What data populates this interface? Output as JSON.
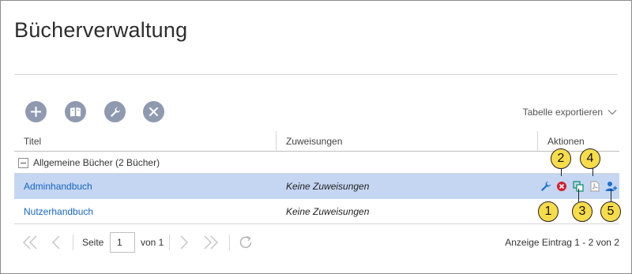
{
  "page": {
    "title": "Bücherverwaltung"
  },
  "toolbar": {
    "buttons": [
      {
        "icon": "plus-icon",
        "label": "Hinzufügen"
      },
      {
        "icon": "book-icon",
        "label": "Bücher"
      },
      {
        "icon": "wrench-icon",
        "label": "Bearbeiten"
      },
      {
        "icon": "close-icon",
        "label": "Löschen"
      }
    ],
    "export_label": "Tabelle exportieren"
  },
  "table": {
    "columns": [
      "Titel",
      "Zuweisungen",
      "Aktionen"
    ],
    "group": {
      "label": "Allgemeine Bücher (2 Bücher)"
    },
    "rows": [
      {
        "title": "Adminhandbuch",
        "assignments": "Keine Zuweisungen",
        "selected": true
      },
      {
        "title": "Nutzerhandbuch",
        "assignments": "Keine Zuweisungen",
        "selected": false
      }
    ],
    "actions": [
      {
        "icon": "wrench-icon",
        "callout": "1",
        "color": "#1a6fd1"
      },
      {
        "icon": "delete-icon",
        "callout": "2",
        "color": "#d21f2b"
      },
      {
        "icon": "copy-icon",
        "callout": "3",
        "color": "#1e9a74"
      },
      {
        "icon": "pdf-icon",
        "callout": "4",
        "color": "#a9a9a9"
      },
      {
        "icon": "user-assign-icon",
        "callout": "5",
        "color": "#1a6fd1"
      }
    ]
  },
  "pager": {
    "page_label": "Seite",
    "page_value": "1",
    "of_label": "von 1",
    "summary": "Anzeige Eintrag 1 - 2 von 2"
  },
  "colors": {
    "toolbar_button": "#8f9ab0",
    "selected_row": "#c5d6f2",
    "link": "#1665c1",
    "callout": "#f7dc4a"
  }
}
